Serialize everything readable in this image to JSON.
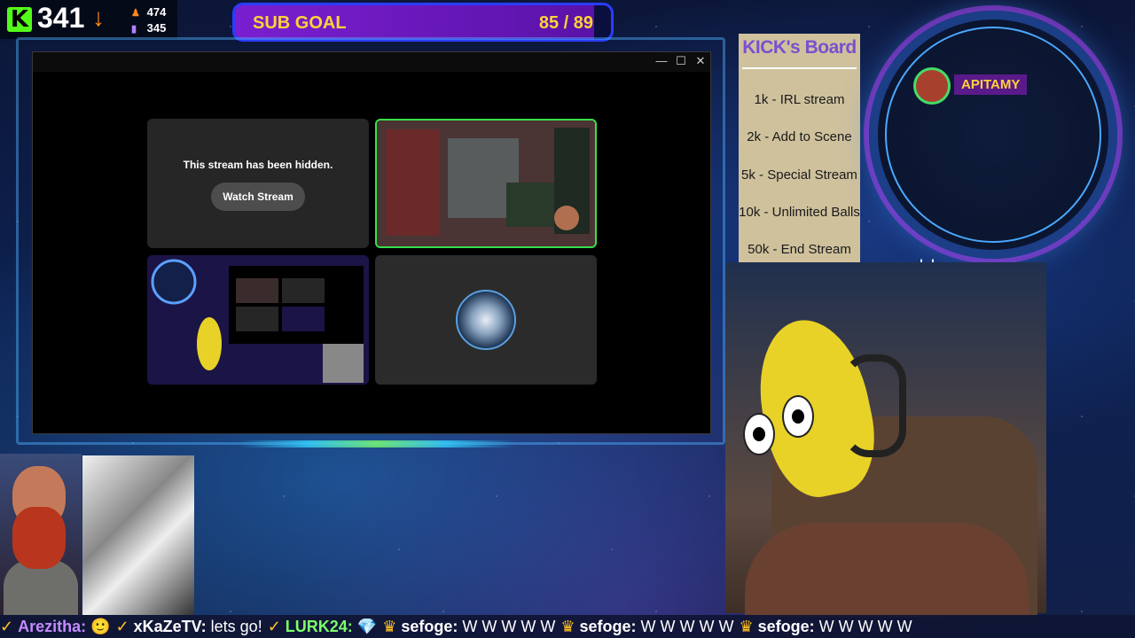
{
  "stats": {
    "followers": "341",
    "trend_icon": "down-arrow-icon",
    "stat1_icon": "person-icon",
    "stat1_value": "474",
    "stat2_icon": "bars-icon",
    "stat2_value": "345"
  },
  "sub_goal": {
    "label": "SUB GOAL",
    "count": "85 / 89",
    "progress": 0.955
  },
  "window": {
    "minimize": "—",
    "maximize": "☐",
    "close": "✕",
    "hidden_message": "This stream has been hidden.",
    "watch_button": "Watch Stream"
  },
  "kick_board": {
    "title": "KICK's Board",
    "items": [
      "1k - IRL stream",
      "2k - Add to Scene",
      "5k - Special Stream",
      "10k - Unlimited Balls",
      "50k - End Stream"
    ]
  },
  "featured_user": {
    "name": "APITAMY"
  },
  "quote_mark": "' '",
  "chat": [
    {
      "user": "Arezitha:",
      "msg": "🙂",
      "color": "#c38bff"
    },
    {
      "user": "xKaZeTV:",
      "msg": "lets go!",
      "color": "#ffffff"
    },
    {
      "user": "LURK24:",
      "msg": "💎",
      "color": "#7dff6a"
    },
    {
      "user": "sefoge:",
      "msg": "W W W W W",
      "color": "#ffffff"
    },
    {
      "user": "sefoge:",
      "msg": "W W W W W",
      "color": "#ffffff"
    },
    {
      "user": "sefoge:",
      "msg": "W W W W W",
      "color": "#ffffff"
    }
  ],
  "colors": {
    "kick_green": "#53fc18",
    "goal_text": "#ffd23a",
    "board_title": "#7a4fd0"
  }
}
